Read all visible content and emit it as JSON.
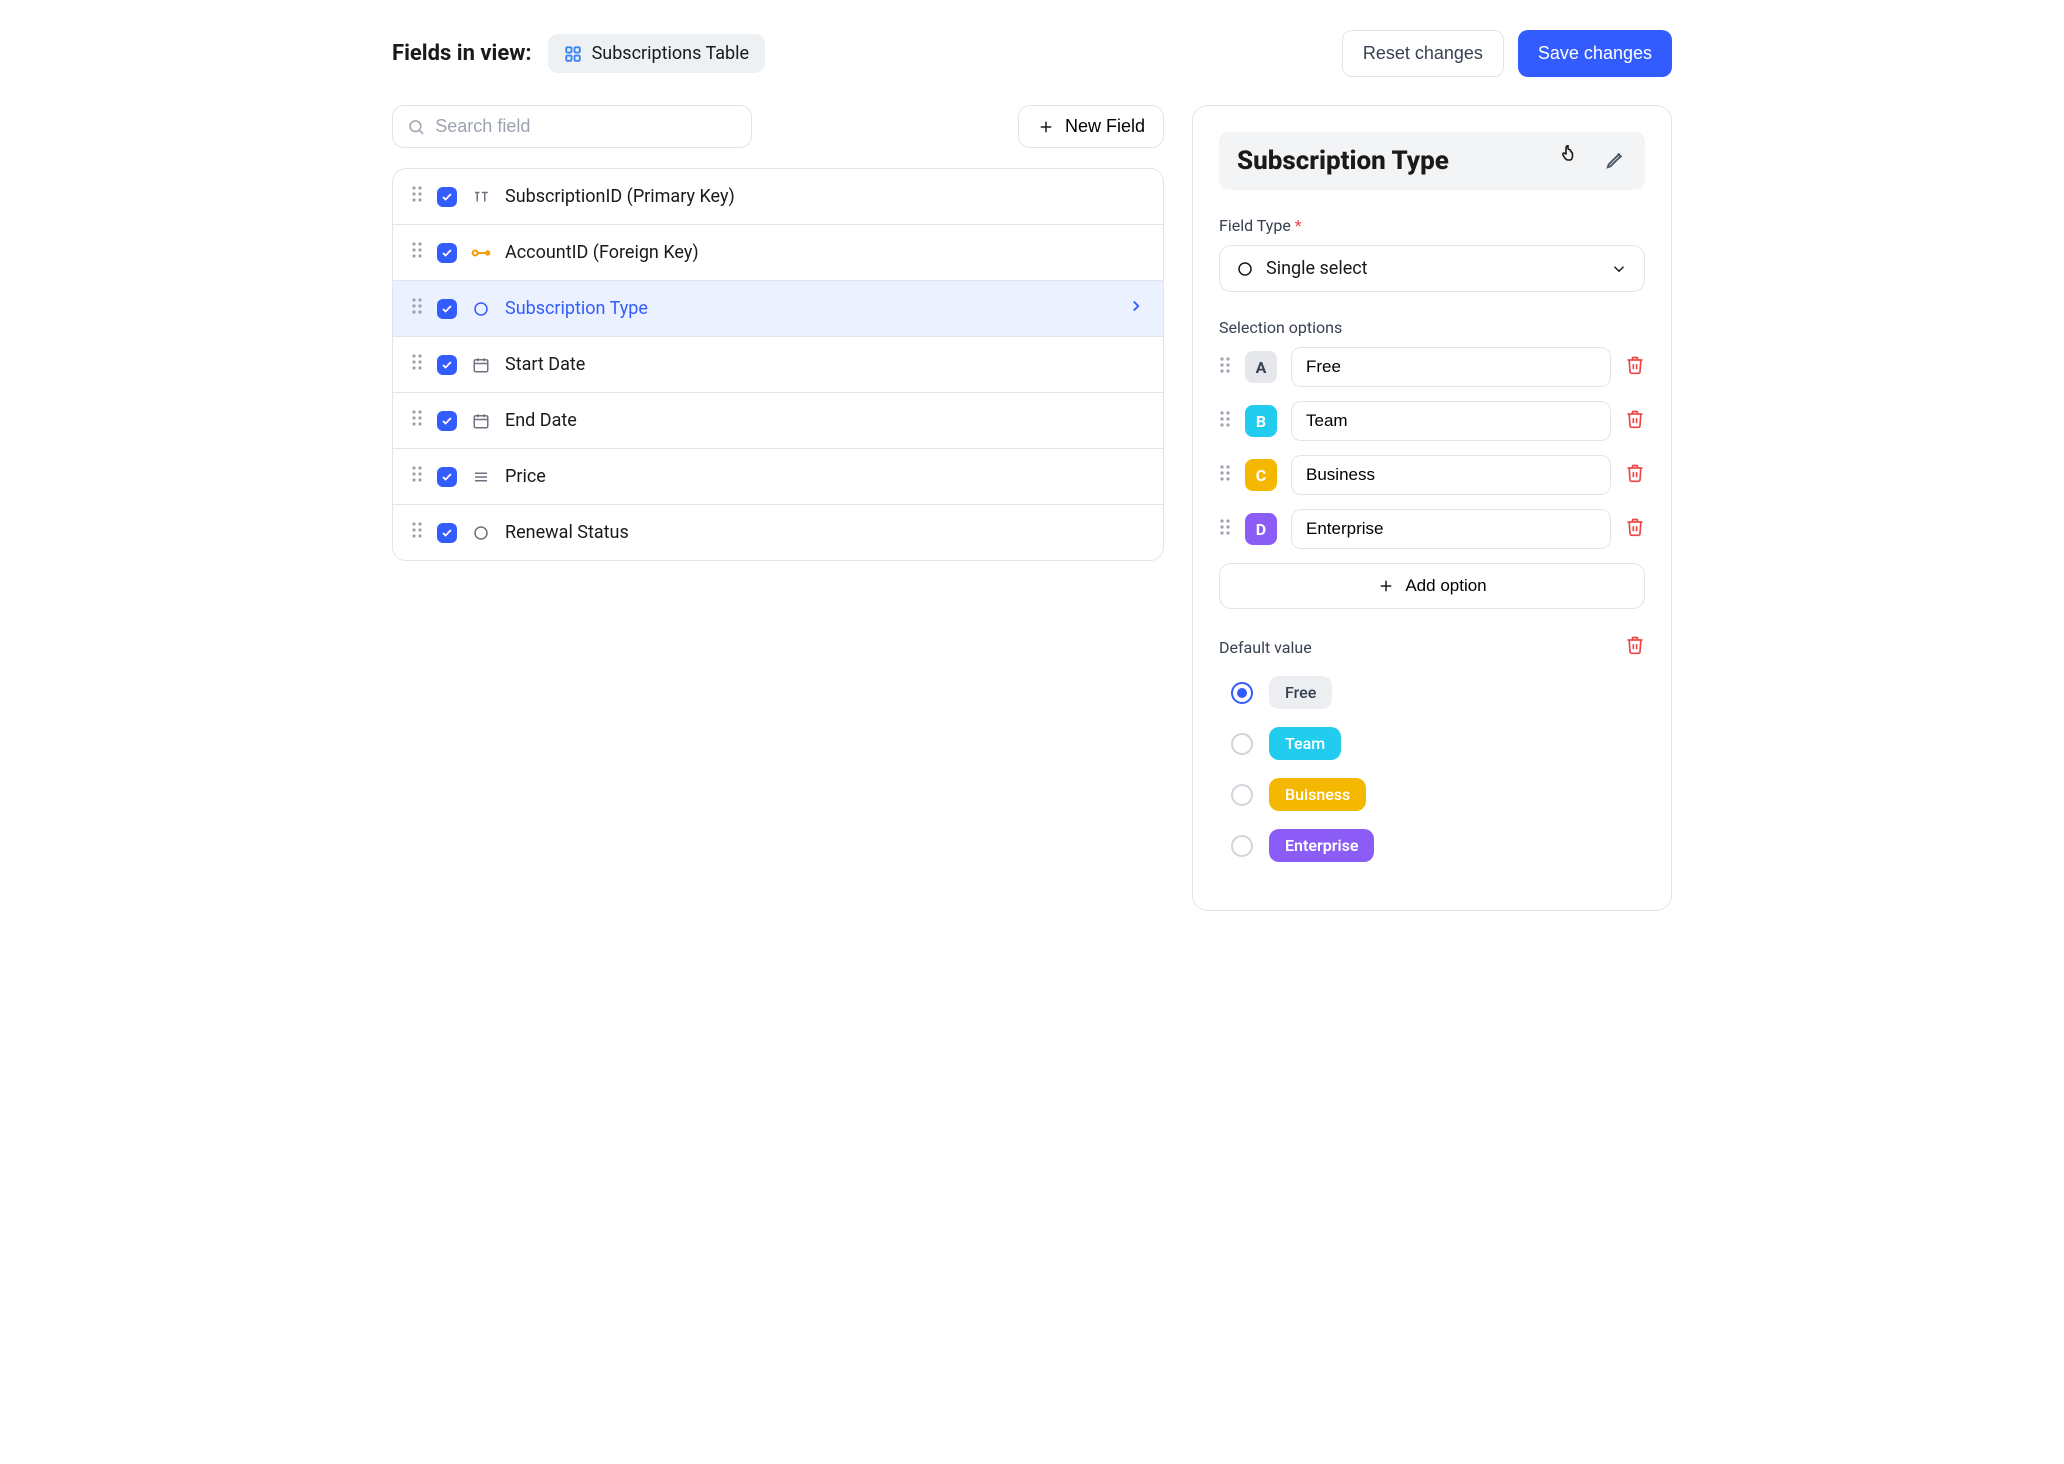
{
  "header": {
    "title": "Fields in view:",
    "chip_label": "Subscriptions Table",
    "reset_label": "Reset changes",
    "save_label": "Save changes"
  },
  "search": {
    "placeholder": "Search field"
  },
  "new_field_label": "New Field",
  "fields": [
    {
      "label": "SubscriptionID (Primary Key)",
      "icon": "text"
    },
    {
      "label": "AccountID (Foreign Key)",
      "icon": "key"
    },
    {
      "label": "Subscription Type",
      "icon": "circle",
      "active": true
    },
    {
      "label": "Start Date",
      "icon": "date"
    },
    {
      "label": "End Date",
      "icon": "date"
    },
    {
      "label": "Price",
      "icon": "list"
    },
    {
      "label": "Renewal Status",
      "icon": "circle"
    }
  ],
  "panel": {
    "title": "Subscription Type",
    "field_type_label": "Field Type",
    "field_type_value": "Single select",
    "selection_options_label": "Selection options",
    "options": [
      {
        "letter": "A",
        "value": "Free",
        "cls": "letter-a"
      },
      {
        "letter": "B",
        "value": "Team",
        "cls": "letter-b"
      },
      {
        "letter": "C",
        "value": "Business",
        "cls": "letter-c"
      },
      {
        "letter": "D",
        "value": "Enterprise",
        "cls": "letter-d"
      }
    ],
    "add_option_label": "Add option",
    "default_value_label": "Default value",
    "defaults": [
      {
        "label": "Free",
        "cls": "pill-gray",
        "checked": true
      },
      {
        "label": "Team",
        "cls": "pill-blue",
        "checked": false
      },
      {
        "label": "Buisness",
        "cls": "pill-yellow",
        "checked": false
      },
      {
        "label": "Enterprise",
        "cls": "pill-purple",
        "checked": false
      }
    ]
  }
}
